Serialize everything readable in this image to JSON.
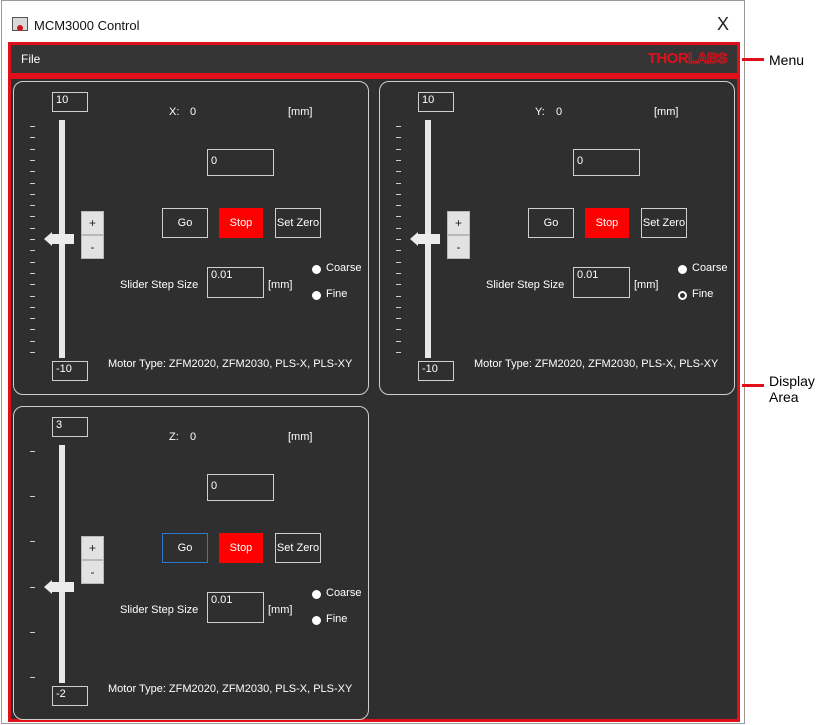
{
  "window": {
    "title": "MCM3000 Control",
    "close_glyph": "X"
  },
  "menu": {
    "file_label": "File",
    "logo_solid": "THOR",
    "logo_outline": "LABS"
  },
  "annotations": {
    "menu_label": "Menu",
    "display_label_line1": "Display",
    "display_label_line2": "Area",
    "highlight_color": "#e0101b"
  },
  "colors": {
    "background": "#2f2f2f",
    "stop": "#ff0000",
    "text": "#ffffff"
  },
  "panels": [
    {
      "axis_label": "X:",
      "position": "0",
      "unit": "[mm]",
      "slider_max": "10",
      "slider_min": "-10",
      "slider_level": 0.5,
      "tick_count": 21,
      "target_value": "0",
      "go_label": "Go",
      "stop_label": "Stop",
      "set_zero_label": "Set Zero",
      "plus_label": "+",
      "minus_label": "-",
      "step_size_label": "Slider Step Size",
      "step_size_value": "0.01",
      "step_unit": "[mm]",
      "coarse_label": "Coarse",
      "fine_label": "Fine",
      "selected_step": "coarse",
      "motor_type": "Motor Type:   ZFM2020, ZFM2030, PLS-X, PLS-XY"
    },
    {
      "axis_label": "Y:",
      "position": "0",
      "unit": "[mm]",
      "slider_max": "10",
      "slider_min": "-10",
      "slider_level": 0.5,
      "tick_count": 21,
      "target_value": "0",
      "go_label": "Go",
      "stop_label": "Stop",
      "set_zero_label": "Set Zero",
      "plus_label": "+",
      "minus_label": "-",
      "step_size_label": "Slider Step Size",
      "step_size_value": "0.01",
      "step_unit": "[mm]",
      "coarse_label": "Coarse",
      "fine_label": "Fine",
      "selected_step": "coarse",
      "motor_type": "Motor Type:   ZFM2020, ZFM2030, PLS-X, PLS-XY"
    },
    {
      "axis_label": "Z:",
      "position": "0",
      "unit": "[mm]",
      "slider_max": "3",
      "slider_min": "-2",
      "slider_level": 0.4,
      "tick_count": 6,
      "target_value": "0",
      "go_label": "Go",
      "stop_label": "Stop",
      "set_zero_label": "Set Zero",
      "plus_label": "+",
      "minus_label": "-",
      "step_size_label": "Slider Step Size",
      "step_size_value": "0.01",
      "step_unit": "[mm]",
      "coarse_label": "Coarse",
      "fine_label": "Fine",
      "selected_step": "fine",
      "motor_type": "Motor Type:   ZFM2020, ZFM2030, PLS-X, PLS-XY"
    }
  ]
}
